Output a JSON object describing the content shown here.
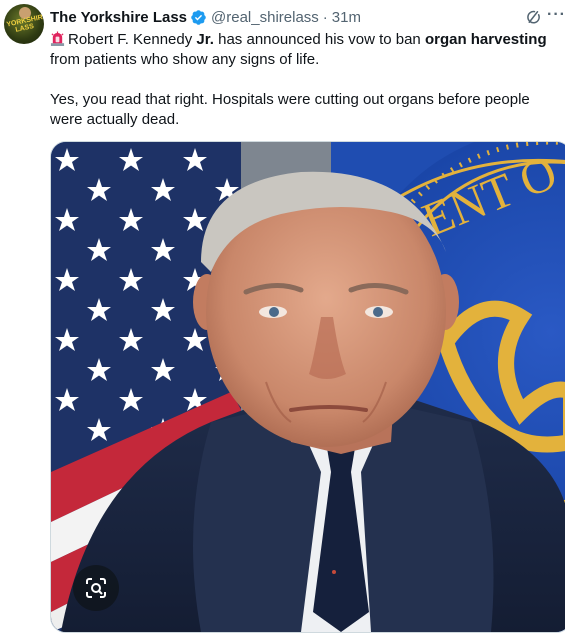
{
  "post": {
    "author_name": "The Yorkshire Lass",
    "handle": "@real_shirelass",
    "separator": "·",
    "time": "31m",
    "verified": true,
    "avatar_text": "YORKSHIRE LASS",
    "paragraph1": {
      "t1": "Robert F. Kennedy ",
      "b1": "Jr.",
      "t2": " has announced his vow to ban ",
      "b2": "organ harvesting",
      "t3": " from patients who show any signs of life."
    },
    "paragraph2": "Yes, you read that right. Hospitals were cutting out organs before people were actually dead.",
    "seal_text": "ENT O"
  },
  "colors": {
    "accent": "#1d9bf0",
    "text": "#0f1419",
    "secondary": "#536471",
    "siren": "#e0245e"
  },
  "icons": [
    "verified-badge-icon",
    "grok-icon",
    "more-icon",
    "siren-emoji-icon",
    "grok-image-icon"
  ]
}
